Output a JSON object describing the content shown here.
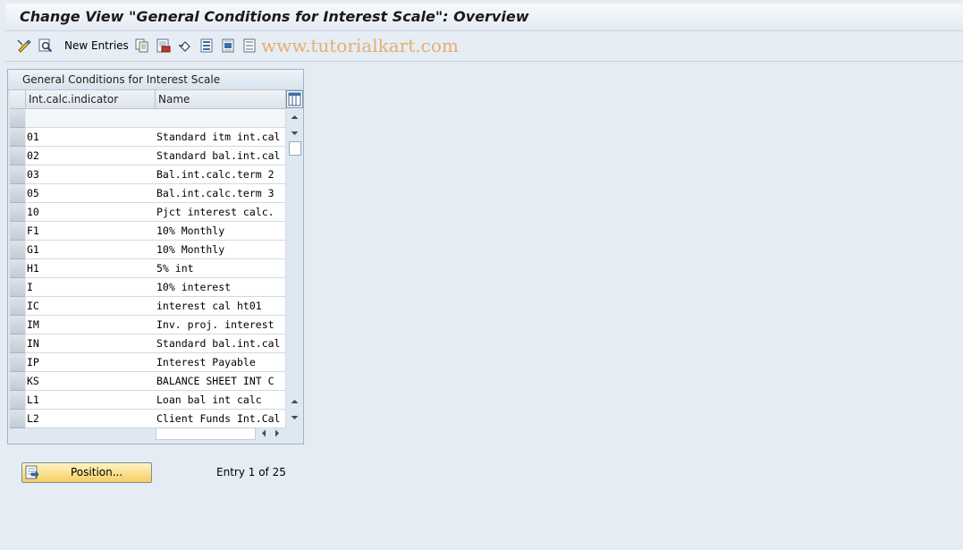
{
  "window": {
    "title": "Change View \"General Conditions for Interest Scale\": Overview",
    "watermark": "www.tutorialkart.com"
  },
  "toolbar": {
    "items": [
      {
        "icon": "display-change-icon"
      },
      {
        "icon": "find-icon"
      },
      {
        "label": "New Entries"
      },
      {
        "icon": "copy-icon"
      },
      {
        "icon": "delete-icon"
      },
      {
        "icon": "undo-icon"
      },
      {
        "icon": "select-all-icon"
      },
      {
        "icon": "select-block-icon"
      },
      {
        "icon": "deselect-all-icon"
      }
    ]
  },
  "table": {
    "title": "General Conditions for Interest Scale",
    "columns": [
      "Int.calc.indicator",
      "Name"
    ],
    "rows": [
      {
        "indicator": "",
        "name": ""
      },
      {
        "indicator": "01",
        "name": "Standard itm int.cal"
      },
      {
        "indicator": "02",
        "name": "Standard bal.int.cal"
      },
      {
        "indicator": "03",
        "name": "Bal.int.calc.term 2"
      },
      {
        "indicator": "05",
        "name": "Bal.int.calc.term 3"
      },
      {
        "indicator": "10",
        "name": "Pjct interest calc."
      },
      {
        "indicator": "F1",
        "name": "10% Monthly"
      },
      {
        "indicator": "G1",
        "name": "10% Monthly"
      },
      {
        "indicator": "H1",
        "name": "5% int"
      },
      {
        "indicator": "I",
        "name": "10% interest"
      },
      {
        "indicator": "IC",
        "name": "interest cal ht01"
      },
      {
        "indicator": "IM",
        "name": "Inv. proj. interest"
      },
      {
        "indicator": "IN",
        "name": "Standard bal.int.cal"
      },
      {
        "indicator": "IP",
        "name": "Interest Payable"
      },
      {
        "indicator": "KS",
        "name": "BALANCE SHEET INT C"
      },
      {
        "indicator": "L1",
        "name": "Loan bal int calc"
      },
      {
        "indicator": "L2",
        "name": "Client Funds Int.Cal"
      }
    ]
  },
  "footer": {
    "position_button": "Position...",
    "entry_info": "Entry 1 of 25"
  }
}
